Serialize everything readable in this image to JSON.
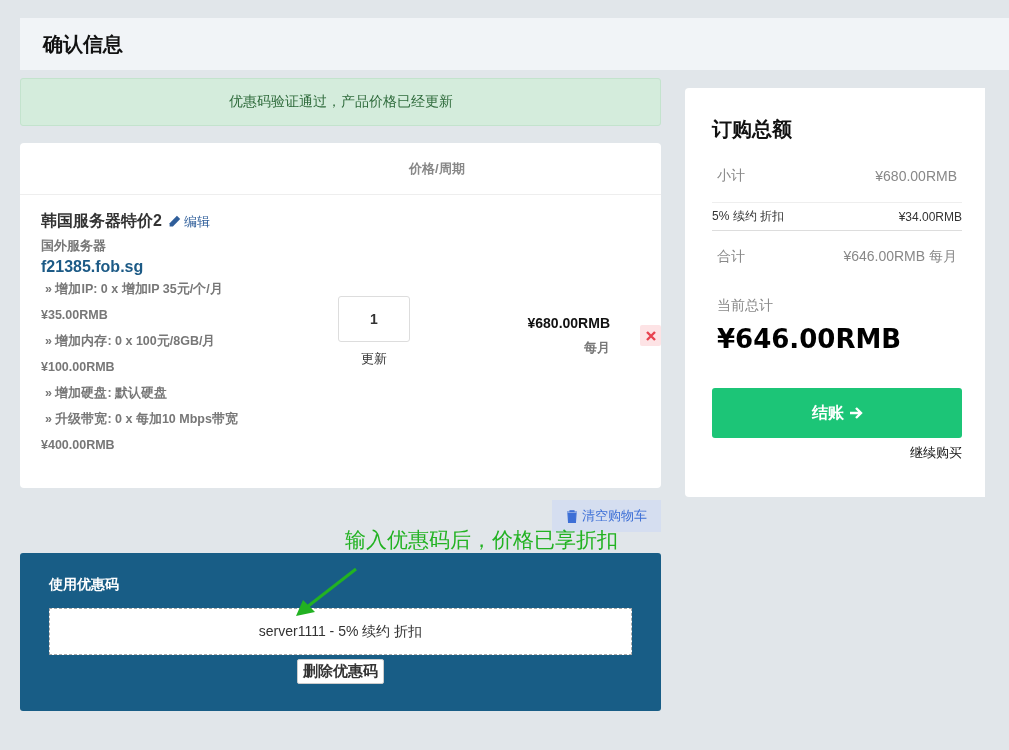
{
  "page_title": "确认信息",
  "alert": "优惠码验证通过，产品价格已经更新",
  "cart": {
    "column_header": "价格/周期",
    "item": {
      "name": "韩国服务器特价2",
      "edit_link": "编辑",
      "group": "国外服务器",
      "domain": "f21385.fob.sg",
      "options": [
        {
          "label": "» 增加IP: 0 x 增加IP 35元/个/月",
          "price": "¥35.00RMB"
        },
        {
          "label": "» 增加内存: 0 x 100元/8GB/月",
          "price": "¥100.00RMB"
        },
        {
          "label": "» 增加硬盘: 默认硬盘"
        },
        {
          "label": "» 升级带宽: 0 x 每加10 Mbps带宽",
          "price": "¥400.00RMB"
        }
      ],
      "quantity": "1",
      "update_label": "更新",
      "price": "¥680.00RMB",
      "cycle": "每月"
    }
  },
  "clear_cart": "清空购物车",
  "annotation": "输入优惠码后，价格已享折扣",
  "promo": {
    "title": "使用优惠码",
    "applied_code": "server1111 - 5% 续约 折扣",
    "remove_button": "删除优惠码"
  },
  "summary": {
    "title": "订购总额",
    "lines": [
      {
        "kind": "plain",
        "label": "小计",
        "value": "¥680.00RMB"
      },
      {
        "kind": "discount",
        "label": "5% 续约 折扣",
        "value": "¥34.00RMB"
      },
      {
        "kind": "plain",
        "label": "合计",
        "value": "¥646.00RMB 每月"
      }
    ],
    "current_total_label": "当前总计",
    "current_total": "¥646.00RMB",
    "checkout_button": "结账",
    "continue_link": "继续购买"
  }
}
